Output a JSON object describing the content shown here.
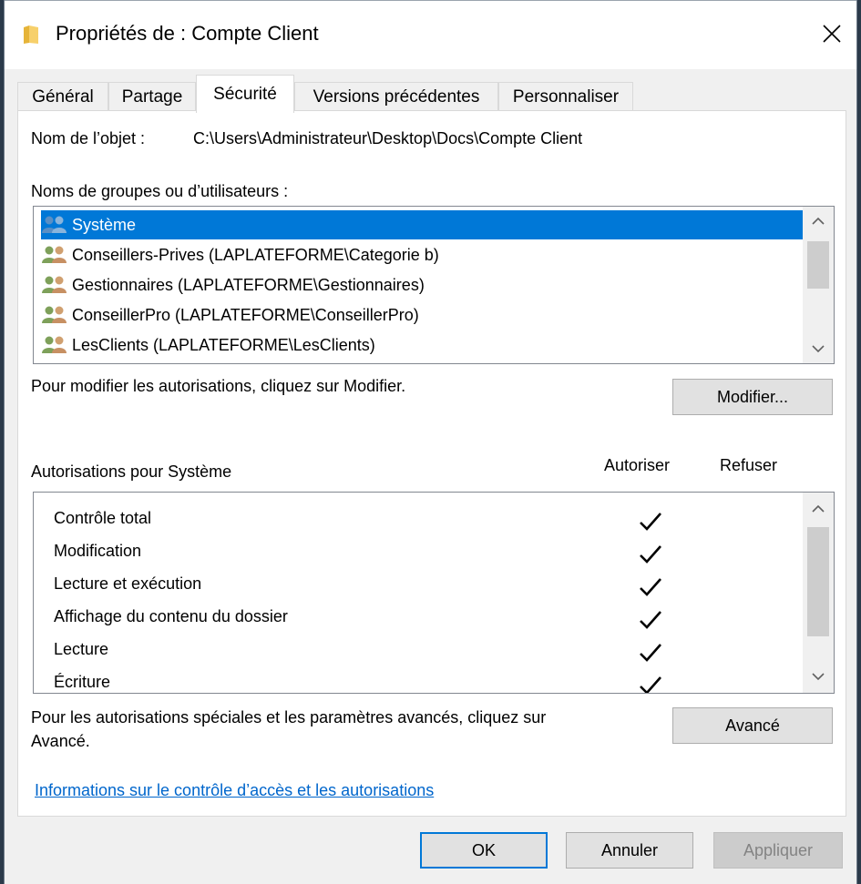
{
  "window": {
    "title": "Propriétés de : Compte Client"
  },
  "tabs": [
    {
      "label": "Général",
      "active": false
    },
    {
      "label": "Partage",
      "active": false
    },
    {
      "label": "Sécurité",
      "active": true
    },
    {
      "label": "Versions précédentes",
      "active": false
    },
    {
      "label": "Personnaliser",
      "active": false
    }
  ],
  "object": {
    "label": "Nom de l’objet :",
    "path": "C:\\Users\\Administrateur\\Desktop\\Docs\\Compte Client"
  },
  "groups": {
    "label": "Noms de groupes ou d’utilisateurs :",
    "items": [
      {
        "name": "Système",
        "selected": true
      },
      {
        "name": "Conseillers-Prives (LAPLATEFORME\\Categorie b)",
        "selected": false
      },
      {
        "name": "Gestionnaires (LAPLATEFORME\\Gestionnaires)",
        "selected": false
      },
      {
        "name": "ConseillerPro (LAPLATEFORME\\ConseillerPro)",
        "selected": false
      },
      {
        "name": "LesClients (LAPLATEFORME\\LesClients)",
        "selected": false
      }
    ]
  },
  "modify": {
    "hint": "Pour modifier les autorisations, cliquez sur Modifier.",
    "button": "Modifier..."
  },
  "permissions": {
    "label": "Autorisations pour Système",
    "allow_header": "Autoriser",
    "deny_header": "Refuser",
    "rows": [
      {
        "name": "Contrôle total",
        "allow": true,
        "deny": false
      },
      {
        "name": "Modification",
        "allow": true,
        "deny": false
      },
      {
        "name": "Lecture et exécution",
        "allow": true,
        "deny": false
      },
      {
        "name": "Affichage du contenu du dossier",
        "allow": true,
        "deny": false
      },
      {
        "name": "Lecture",
        "allow": true,
        "deny": false
      },
      {
        "name": "Écriture",
        "allow": true,
        "deny": false
      }
    ]
  },
  "advanced": {
    "hint_line1": "Pour les autorisations spéciales et les paramètres avancés, cliquez sur",
    "hint_line2": "Avancé.",
    "button": "Avancé"
  },
  "link": "Informations sur le contrôle d’accès et les autorisations",
  "footer": {
    "ok": "OK",
    "cancel": "Annuler",
    "apply": "Appliquer"
  },
  "colors": {
    "selection": "#0078d7",
    "link": "#0066cc"
  },
  "icons": {
    "folder": "folder-icon",
    "close": "close-icon",
    "user_group": "user-group-icon",
    "check": "check-icon"
  }
}
